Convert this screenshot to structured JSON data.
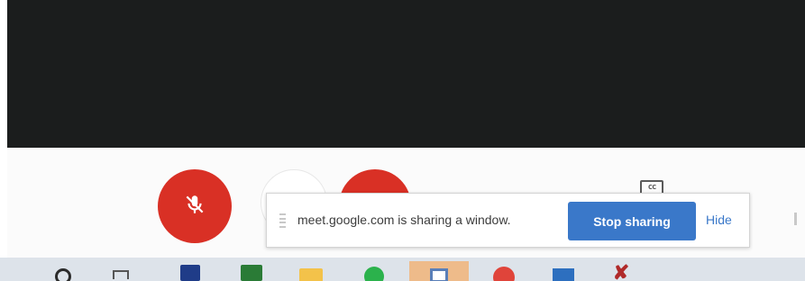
{
  "meeting": {
    "mic_state": "muted",
    "camera_state": "off",
    "captions_label": "cc"
  },
  "sharing_bar": {
    "message": "meet.google.com is sharing a window.",
    "stop_label": "Stop sharing",
    "hide_label": "Hide"
  },
  "taskbar": {
    "items": [
      {
        "icon": "search-icon"
      },
      {
        "icon": "task-view-icon"
      },
      {
        "icon": "save-app-icon"
      },
      {
        "icon": "excel-icon"
      },
      {
        "icon": "file-explorer-icon"
      },
      {
        "icon": "spotify-icon"
      },
      {
        "icon": "window-app-icon",
        "active": true
      },
      {
        "icon": "chrome-icon"
      },
      {
        "icon": "outlook-icon"
      },
      {
        "icon": "x-app-icon"
      }
    ]
  },
  "colors": {
    "meet_red": "#d93025",
    "stop_blue": "#3a78c9",
    "video_bg": "#1b1d1d",
    "taskbar_bg": "#dde3ea",
    "active_task": "#eebb8a"
  }
}
